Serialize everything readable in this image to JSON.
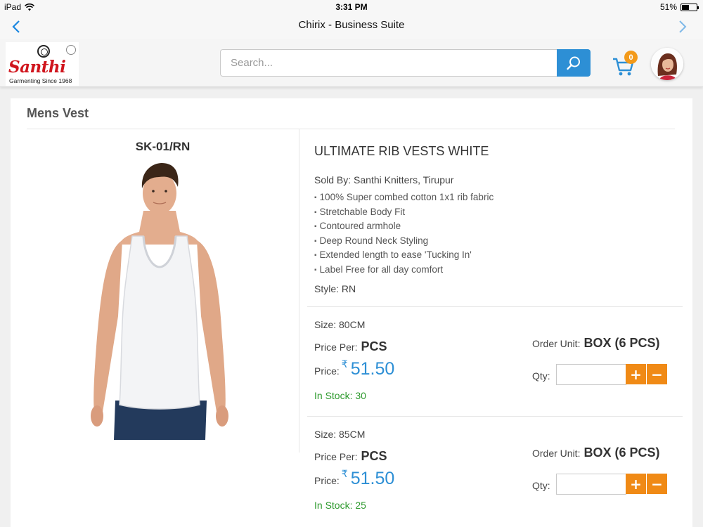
{
  "status_bar": {
    "device": "iPad",
    "time": "3:31 PM",
    "battery": "51%",
    "battery_level": 0.51
  },
  "nav": {
    "title": "Chirix - Business Suite",
    "back_icon": "chevron-left-icon",
    "forward_icon": "chevron-right-icon"
  },
  "header": {
    "logo": {
      "brand": "Santhi",
      "tagline": "Garmenting Since 1968"
    },
    "search": {
      "placeholder": "Search...",
      "value": "",
      "icon": "search-icon"
    },
    "cart": {
      "count": "0",
      "icon": "cart-icon"
    },
    "avatar_icon": "user-avatar"
  },
  "page": {
    "section_title": "Mens Vest",
    "sku": "SK-01/RN",
    "product_name": "ULTIMATE RIB VESTS WHITE",
    "sold_by_label": "Sold By:",
    "sold_by_value": "Santhi Knitters, Tirupur",
    "features": [
      "100% Super combed cotton 1x1 rib fabric",
      "Stretchable Body Fit",
      "Contoured armhole",
      "Deep Round Neck Styling",
      "Extended length to ease 'Tucking In'",
      "Label Free for all day comfort"
    ],
    "style_label": "Style:",
    "style_value": "RN"
  },
  "variants": [
    {
      "size_label": "Size:",
      "size_value": "80CM",
      "price_per_label": "Price Per:",
      "price_per_value": "PCS",
      "price_label": "Price:",
      "currency": "₹",
      "price": "51.50",
      "stock_label": "In Stock:",
      "stock_value": "30",
      "order_unit_label": "Order Unit:",
      "order_unit_value": "BOX (6 PCS)",
      "qty_label": "Qty:",
      "qty_value": "",
      "plus": "+",
      "minus": "−"
    },
    {
      "size_label": "Size:",
      "size_value": "85CM",
      "price_per_label": "Price Per:",
      "price_per_value": "PCS",
      "price_label": "Price:",
      "currency": "₹",
      "price": "51.50",
      "stock_label": "In Stock:",
      "stock_value": "25",
      "order_unit_label": "Order Unit:",
      "order_unit_value": "BOX (6 PCS)",
      "qty_label": "Qty:",
      "qty_value": "",
      "plus": "+",
      "minus": "−"
    }
  ],
  "colors": {
    "accent_blue": "#2d8fd5",
    "qty_button_orange": "#f08a16",
    "cart_badge": "#f39a1a",
    "in_stock_green": "#2e9a2e",
    "brand_red": "#d0151d"
  }
}
